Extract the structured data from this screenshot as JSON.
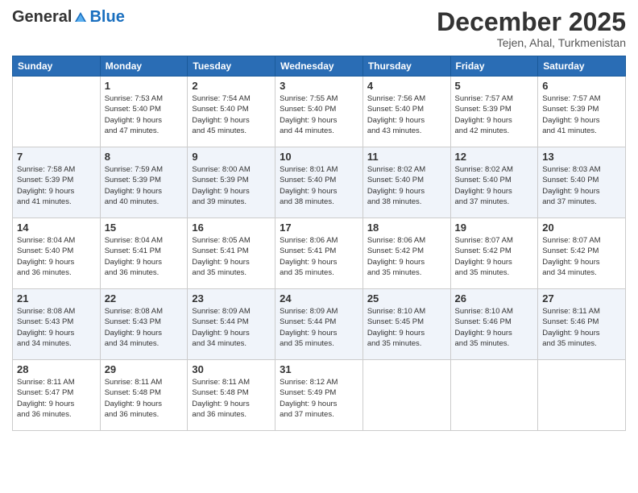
{
  "header": {
    "logo": {
      "general": "General",
      "blue": "Blue"
    },
    "title": "December 2025",
    "location": "Tejen, Ahal, Turkmenistan"
  },
  "weekdays": [
    "Sunday",
    "Monday",
    "Tuesday",
    "Wednesday",
    "Thursday",
    "Friday",
    "Saturday"
  ],
  "weeks": [
    [
      {
        "day": "",
        "info": ""
      },
      {
        "day": "1",
        "info": "Sunrise: 7:53 AM\nSunset: 5:40 PM\nDaylight: 9 hours\nand 47 minutes."
      },
      {
        "day": "2",
        "info": "Sunrise: 7:54 AM\nSunset: 5:40 PM\nDaylight: 9 hours\nand 45 minutes."
      },
      {
        "day": "3",
        "info": "Sunrise: 7:55 AM\nSunset: 5:40 PM\nDaylight: 9 hours\nand 44 minutes."
      },
      {
        "day": "4",
        "info": "Sunrise: 7:56 AM\nSunset: 5:40 PM\nDaylight: 9 hours\nand 43 minutes."
      },
      {
        "day": "5",
        "info": "Sunrise: 7:57 AM\nSunset: 5:39 PM\nDaylight: 9 hours\nand 42 minutes."
      },
      {
        "day": "6",
        "info": "Sunrise: 7:57 AM\nSunset: 5:39 PM\nDaylight: 9 hours\nand 41 minutes."
      }
    ],
    [
      {
        "day": "7",
        "info": "Sunrise: 7:58 AM\nSunset: 5:39 PM\nDaylight: 9 hours\nand 41 minutes."
      },
      {
        "day": "8",
        "info": "Sunrise: 7:59 AM\nSunset: 5:39 PM\nDaylight: 9 hours\nand 40 minutes."
      },
      {
        "day": "9",
        "info": "Sunrise: 8:00 AM\nSunset: 5:39 PM\nDaylight: 9 hours\nand 39 minutes."
      },
      {
        "day": "10",
        "info": "Sunrise: 8:01 AM\nSunset: 5:40 PM\nDaylight: 9 hours\nand 38 minutes."
      },
      {
        "day": "11",
        "info": "Sunrise: 8:02 AM\nSunset: 5:40 PM\nDaylight: 9 hours\nand 38 minutes."
      },
      {
        "day": "12",
        "info": "Sunrise: 8:02 AM\nSunset: 5:40 PM\nDaylight: 9 hours\nand 37 minutes."
      },
      {
        "day": "13",
        "info": "Sunrise: 8:03 AM\nSunset: 5:40 PM\nDaylight: 9 hours\nand 37 minutes."
      }
    ],
    [
      {
        "day": "14",
        "info": "Sunrise: 8:04 AM\nSunset: 5:40 PM\nDaylight: 9 hours\nand 36 minutes."
      },
      {
        "day": "15",
        "info": "Sunrise: 8:04 AM\nSunset: 5:41 PM\nDaylight: 9 hours\nand 36 minutes."
      },
      {
        "day": "16",
        "info": "Sunrise: 8:05 AM\nSunset: 5:41 PM\nDaylight: 9 hours\nand 35 minutes."
      },
      {
        "day": "17",
        "info": "Sunrise: 8:06 AM\nSunset: 5:41 PM\nDaylight: 9 hours\nand 35 minutes."
      },
      {
        "day": "18",
        "info": "Sunrise: 8:06 AM\nSunset: 5:42 PM\nDaylight: 9 hours\nand 35 minutes."
      },
      {
        "day": "19",
        "info": "Sunrise: 8:07 AM\nSunset: 5:42 PM\nDaylight: 9 hours\nand 35 minutes."
      },
      {
        "day": "20",
        "info": "Sunrise: 8:07 AM\nSunset: 5:42 PM\nDaylight: 9 hours\nand 34 minutes."
      }
    ],
    [
      {
        "day": "21",
        "info": "Sunrise: 8:08 AM\nSunset: 5:43 PM\nDaylight: 9 hours\nand 34 minutes."
      },
      {
        "day": "22",
        "info": "Sunrise: 8:08 AM\nSunset: 5:43 PM\nDaylight: 9 hours\nand 34 minutes."
      },
      {
        "day": "23",
        "info": "Sunrise: 8:09 AM\nSunset: 5:44 PM\nDaylight: 9 hours\nand 34 minutes."
      },
      {
        "day": "24",
        "info": "Sunrise: 8:09 AM\nSunset: 5:44 PM\nDaylight: 9 hours\nand 35 minutes."
      },
      {
        "day": "25",
        "info": "Sunrise: 8:10 AM\nSunset: 5:45 PM\nDaylight: 9 hours\nand 35 minutes."
      },
      {
        "day": "26",
        "info": "Sunrise: 8:10 AM\nSunset: 5:46 PM\nDaylight: 9 hours\nand 35 minutes."
      },
      {
        "day": "27",
        "info": "Sunrise: 8:11 AM\nSunset: 5:46 PM\nDaylight: 9 hours\nand 35 minutes."
      }
    ],
    [
      {
        "day": "28",
        "info": "Sunrise: 8:11 AM\nSunset: 5:47 PM\nDaylight: 9 hours\nand 36 minutes."
      },
      {
        "day": "29",
        "info": "Sunrise: 8:11 AM\nSunset: 5:48 PM\nDaylight: 9 hours\nand 36 minutes."
      },
      {
        "day": "30",
        "info": "Sunrise: 8:11 AM\nSunset: 5:48 PM\nDaylight: 9 hours\nand 36 minutes."
      },
      {
        "day": "31",
        "info": "Sunrise: 8:12 AM\nSunset: 5:49 PM\nDaylight: 9 hours\nand 37 minutes."
      },
      {
        "day": "",
        "info": ""
      },
      {
        "day": "",
        "info": ""
      },
      {
        "day": "",
        "info": ""
      }
    ]
  ]
}
